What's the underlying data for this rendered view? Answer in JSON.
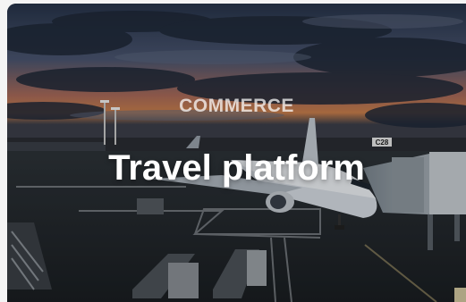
{
  "card": {
    "category": "COMMERCE",
    "title": "Travel platform",
    "image_subject": "airplane-at-airport-gate-at-dusk",
    "gate_sign": "C28"
  }
}
